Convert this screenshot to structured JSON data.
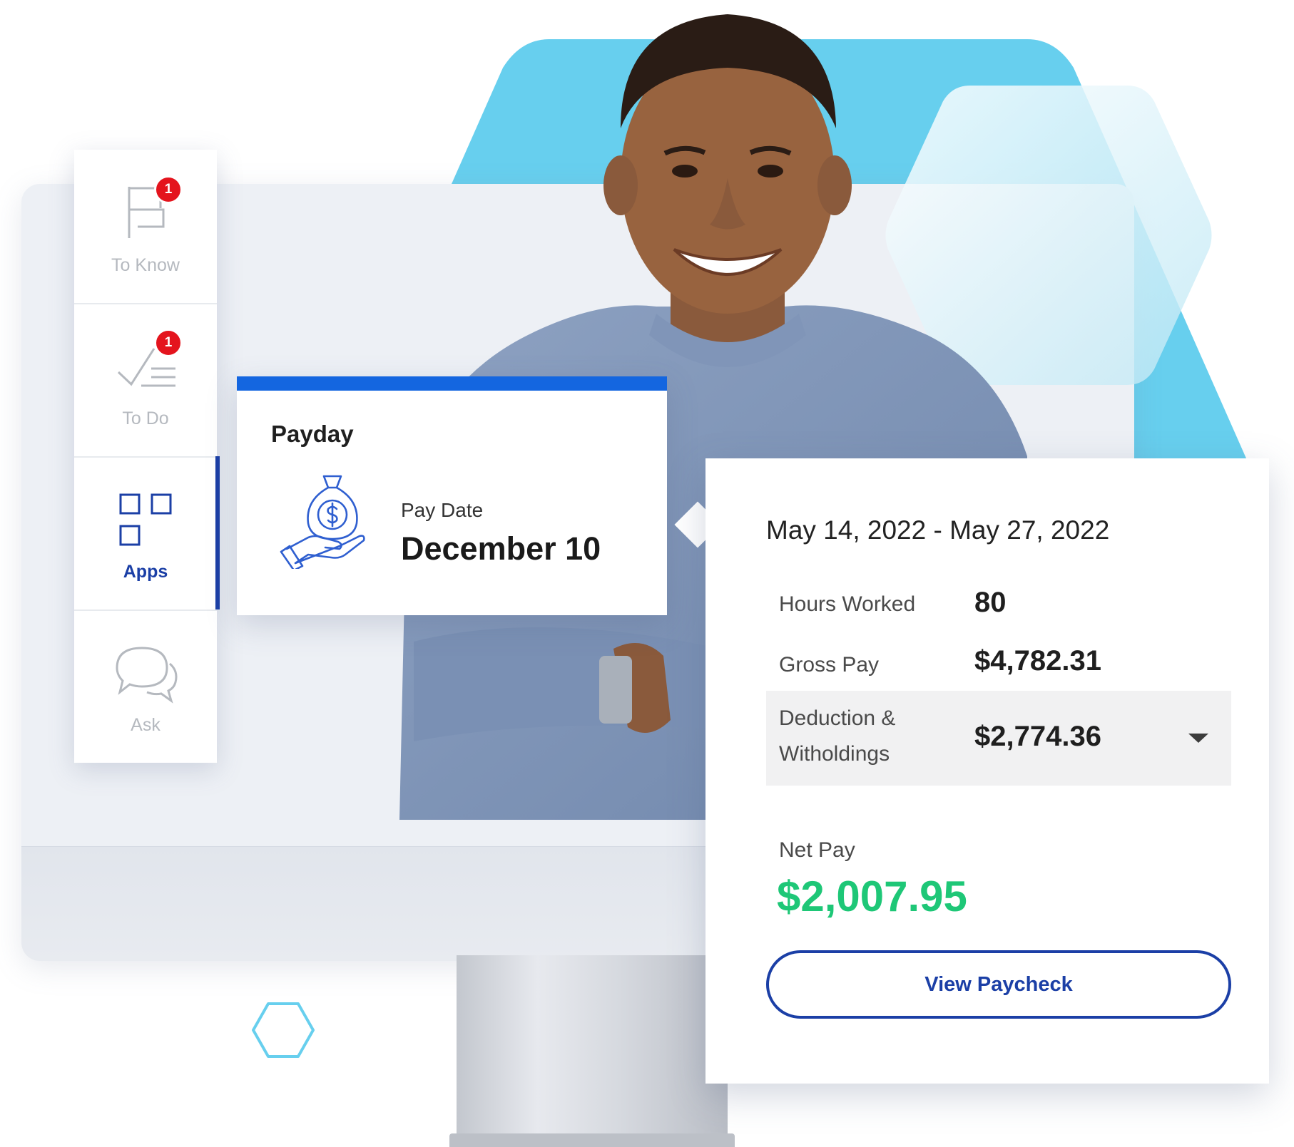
{
  "sidebar": {
    "items": [
      {
        "label": "To Know",
        "icon": "flag-icon",
        "badge": "1",
        "active": false
      },
      {
        "label": "To Do",
        "icon": "checklist-icon",
        "badge": "1",
        "active": false
      },
      {
        "label": "Apps",
        "icon": "apps-grid-icon",
        "active": true
      },
      {
        "label": "Ask",
        "icon": "chat-bubbles-icon",
        "active": false
      }
    ]
  },
  "payday": {
    "title": "Payday",
    "icon": "money-bag-hand-icon",
    "pay_date_label": "Pay Date",
    "pay_date_value": "December 10"
  },
  "paycheck": {
    "period": "May 14, 2022 - May 27, 2022",
    "hours_label": "Hours Worked",
    "hours_value": "80",
    "gross_label": "Gross Pay",
    "gross_value": "$4,782.31",
    "deduction_label_line1": "Deduction &",
    "deduction_label_line2": "Witholdings",
    "deduction_value": "$2,774.36",
    "net_label": "Net Pay",
    "net_value": "$2,007.95",
    "view_button": "View Paycheck"
  },
  "colors": {
    "accent_blue": "#1b3fa6",
    "payday_bar": "#1466e0",
    "net_green": "#1ec777",
    "badge_red": "#e4141d",
    "hex_cyan": "#67cfee"
  }
}
